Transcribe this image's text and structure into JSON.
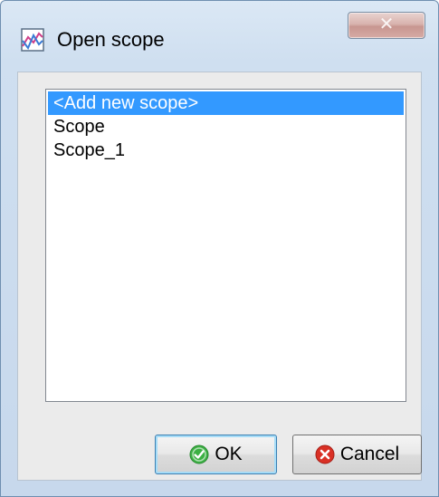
{
  "window": {
    "title": "Open scope",
    "title_icon": "scope-chart-icon",
    "close_icon": "close-icon"
  },
  "list": {
    "items": [
      {
        "label": "<Add new scope>",
        "selected": true
      },
      {
        "label": "Scope",
        "selected": false
      },
      {
        "label": "Scope_1",
        "selected": false
      }
    ]
  },
  "buttons": {
    "ok_label": "OK",
    "ok_icon": "check-icon",
    "cancel_label": "Cancel",
    "cancel_icon": "cancel-icon"
  },
  "colors": {
    "selection": "#3399ff",
    "ok_icon": "#3cb043",
    "cancel_icon": "#d93025"
  }
}
